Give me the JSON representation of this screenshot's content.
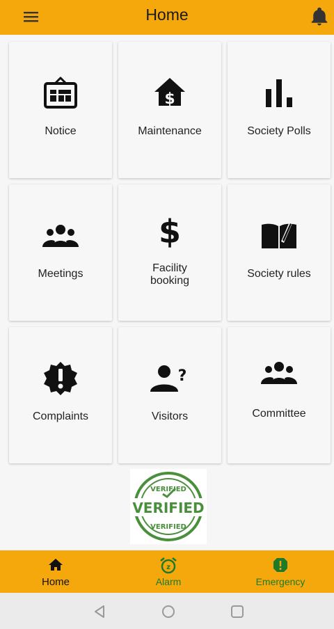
{
  "header": {
    "title": "Home",
    "menu_icon": "hamburger-menu-icon",
    "notification_icon": "bell-icon"
  },
  "tiles": [
    {
      "label": "Notice",
      "icon": "notice-board-icon"
    },
    {
      "label": "Maintenance",
      "icon": "house-dollar-icon"
    },
    {
      "label": "Society Polls",
      "icon": "bar-chart-icon"
    },
    {
      "label": "Meetings",
      "icon": "group-icon"
    },
    {
      "label": "Facility booking",
      "icon": "dollar-icon"
    },
    {
      "label": "Society rules",
      "icon": "book-icon"
    },
    {
      "label": "Complaints",
      "icon": "alert-badge-icon"
    },
    {
      "label": "Visitors",
      "icon": "person-question-icon"
    },
    {
      "label": "Committee",
      "icon": "group-icon"
    }
  ],
  "badge": {
    "image": "verified-stamp",
    "text": "VERIFIED"
  },
  "bottom_nav": {
    "items": [
      {
        "label": "Home",
        "icon": "home-icon",
        "color": "#111111"
      },
      {
        "label": "Alarm",
        "icon": "alarm-clock-icon",
        "color": "#1e7a2a"
      },
      {
        "label": "Emergency",
        "icon": "emergency-alert-icon",
        "color": "#1e7a2a"
      }
    ],
    "active": "Home"
  },
  "colors": {
    "accent": "#f5a80c",
    "green": "#1e7a2a",
    "verified_green": "#4a8f3c"
  }
}
